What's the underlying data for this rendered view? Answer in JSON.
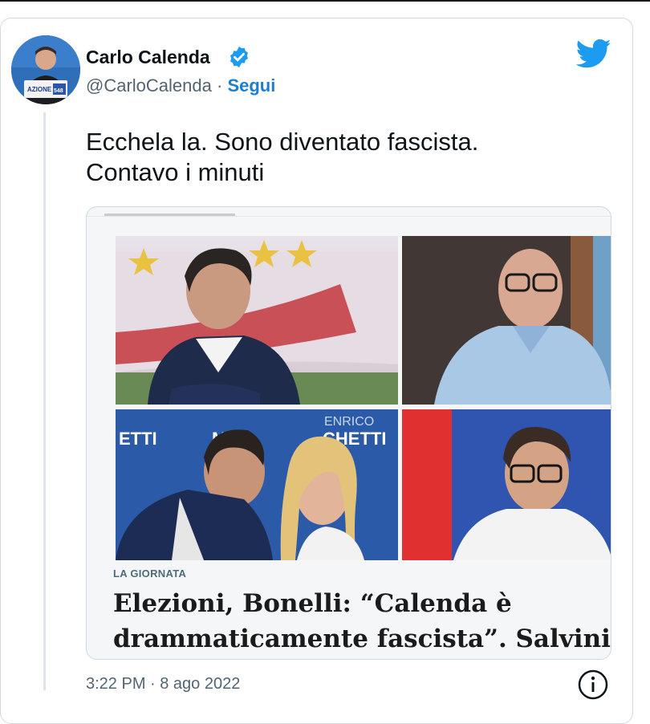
{
  "tweet": {
    "author_name": "Carlo Calenda",
    "handle": "@CarloCalenda",
    "separator": "·",
    "follow_label": "Segui",
    "text_lines": [
      "Ecchela la. Sono diventato fascista.",
      "Contavo i minuti"
    ],
    "timestamp": "3:22 PM · 8 ago 2022"
  },
  "avatar": {
    "badge_text": "AZIONE",
    "number": "548"
  },
  "photos": {
    "salvini_background_texts": [
      "ENRICO",
      "ETTI",
      "MI",
      "CHETTI"
    ]
  },
  "link_card": {
    "section": "LA GIORNATA",
    "headline_lines": [
      "Elezioni, Bonelli: “Calenda è",
      "drammaticamente fascista”. Salvini"
    ]
  },
  "colors": {
    "brand_blue": "#1d9bf0",
    "follow_blue": "#1d7fd1",
    "text": "#0f1419",
    "muted": "#536471"
  },
  "icons": [
    "verified-badge-icon",
    "twitter-bird-icon",
    "info-icon"
  ]
}
